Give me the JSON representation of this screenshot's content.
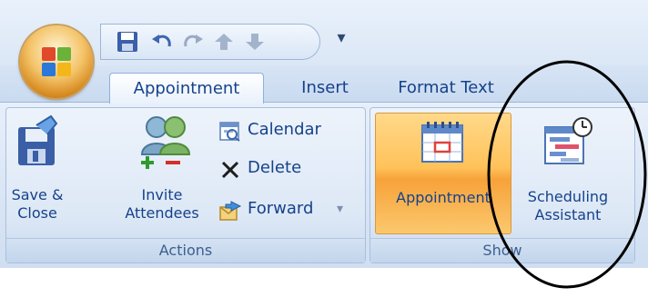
{
  "quick_access": {
    "items": [
      {
        "name": "save-icon"
      },
      {
        "name": "undo-icon"
      },
      {
        "name": "redo-icon"
      },
      {
        "name": "previous-item-icon"
      },
      {
        "name": "next-item-icon"
      }
    ],
    "more": "▾"
  },
  "tabs": [
    {
      "label": "Appointment",
      "active": true
    },
    {
      "label": "Insert",
      "active": false
    },
    {
      "label": "Format Text",
      "active": false
    }
  ],
  "groups": {
    "actions": {
      "label": "Actions",
      "save_close": {
        "line1": "Save &",
        "line2": "Close"
      },
      "invite": {
        "line1": "Invite",
        "line2": "Attendees"
      },
      "calendar": "Calendar",
      "delete": "Delete",
      "forward": "Forward",
      "forward_arrow": "▾"
    },
    "show": {
      "label": "Show",
      "appointment": "Appointment",
      "scheduling": {
        "line1": "Scheduling",
        "line2": "Assistant"
      }
    }
  },
  "colors": {
    "accent": "#ffc25a",
    "text": "#15428b",
    "annotation": "#000000"
  }
}
